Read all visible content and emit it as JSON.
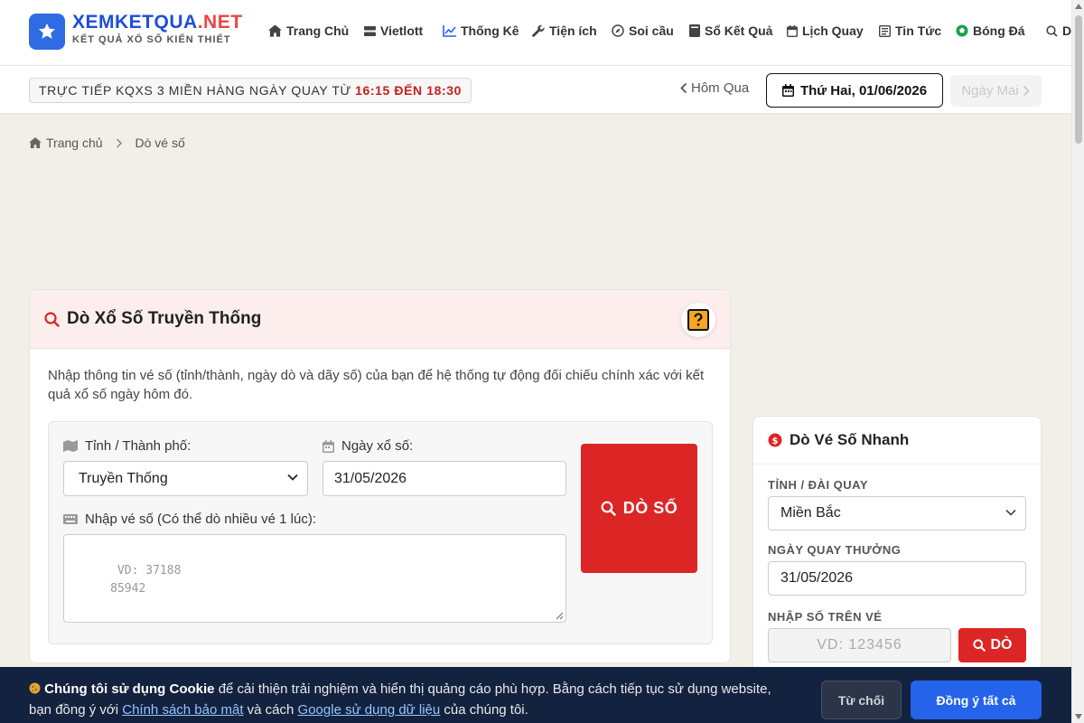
{
  "brand": {
    "name_main": "XEMKETQUA",
    "name_suffix": ".NET",
    "tagline": "KẾT QUẢ XỔ SỐ KIẾN THIẾT",
    "accent": "#2f6be3",
    "suffix_color": "#ef4444"
  },
  "nav": [
    {
      "label": "Trang Chủ",
      "icon": "home-icon"
    },
    {
      "label": "Vietlott",
      "icon": "server-icon"
    },
    {
      "label": "Thống Kê",
      "icon": "chart-line-icon"
    },
    {
      "label": "Tiện ích",
      "icon": "wrench-icon"
    },
    {
      "label": "Soi cầu",
      "icon": "compass-icon"
    },
    {
      "label": "Sổ Kết Quả",
      "icon": "book-icon"
    },
    {
      "label": "Lịch Quay",
      "icon": "calendar-icon"
    },
    {
      "label": "Tin Tức",
      "icon": "newspaper-icon"
    },
    {
      "label": "Bóng Đá",
      "icon": "football-icon"
    },
    {
      "label": "D",
      "icon": "search-icon"
    }
  ],
  "livebar": {
    "text": "TRỰC TIẾP KQXS 3 MIỀN HÀNG NGÀY QUAY TỪ",
    "time": "16:15 ĐẾN 18:30",
    "prev_label": "Hôm Qua",
    "current_date": "Thứ Hai, 01/06/2026",
    "next_label": "Ngày Mai"
  },
  "breadcrumb": {
    "home": "Trang chủ",
    "current": "Dò vé số"
  },
  "main_card": {
    "title": "Dò Xổ Số Truyền Thống",
    "description": "Nhập thông tin vé số (tỉnh/thành, ngày dò và dãy số) của bạn để hệ thống tự động đối chiếu chính xác với kết quả xổ số ngày hôm đó.",
    "province_label": "Tỉnh / Thành phố:",
    "province_value": "Truyền Thống",
    "date_label": "Ngày xổ số:",
    "date_value": "31/05/2026",
    "tickets_label": "Nhập vé số (Có thể dò nhiều vé 1 lúc):",
    "tickets_placeholder": "VD: 37188\n     85942",
    "submit_label": "DÒ SỐ"
  },
  "side_card": {
    "title": "Dò Vé Số Nhanh",
    "region_label": "TỈNH / ĐÀI QUAY",
    "region_value": "Miền Bắc",
    "date_label": "NGÀY QUAY THƯỞNG",
    "date_value": "31/05/2026",
    "number_label": "NHẬP SỐ TRÊN VÉ",
    "number_placeholder": "VD: 123456",
    "submit_label": "DÒ"
  },
  "cookie": {
    "title": "Chúng tôi sử dụng Cookie",
    "text_1": "để cải thiện trải nghiệm và hiển thị quảng cáo phù hợp. Bằng cách tiếp tục sử dụng website, bạn đồng ý với",
    "link_privacy": "Chính sách bảo mật",
    "text_2": "và cách",
    "link_google": "Google sử dụng dữ liệu",
    "text_3": "của chúng tôi.",
    "reject_label": "Từ chối",
    "accept_label": "Đồng ý tất cả"
  },
  "colors": {
    "danger": "#dc2626",
    "primary": "#2563eb",
    "cookie_bg": "#13223f"
  }
}
